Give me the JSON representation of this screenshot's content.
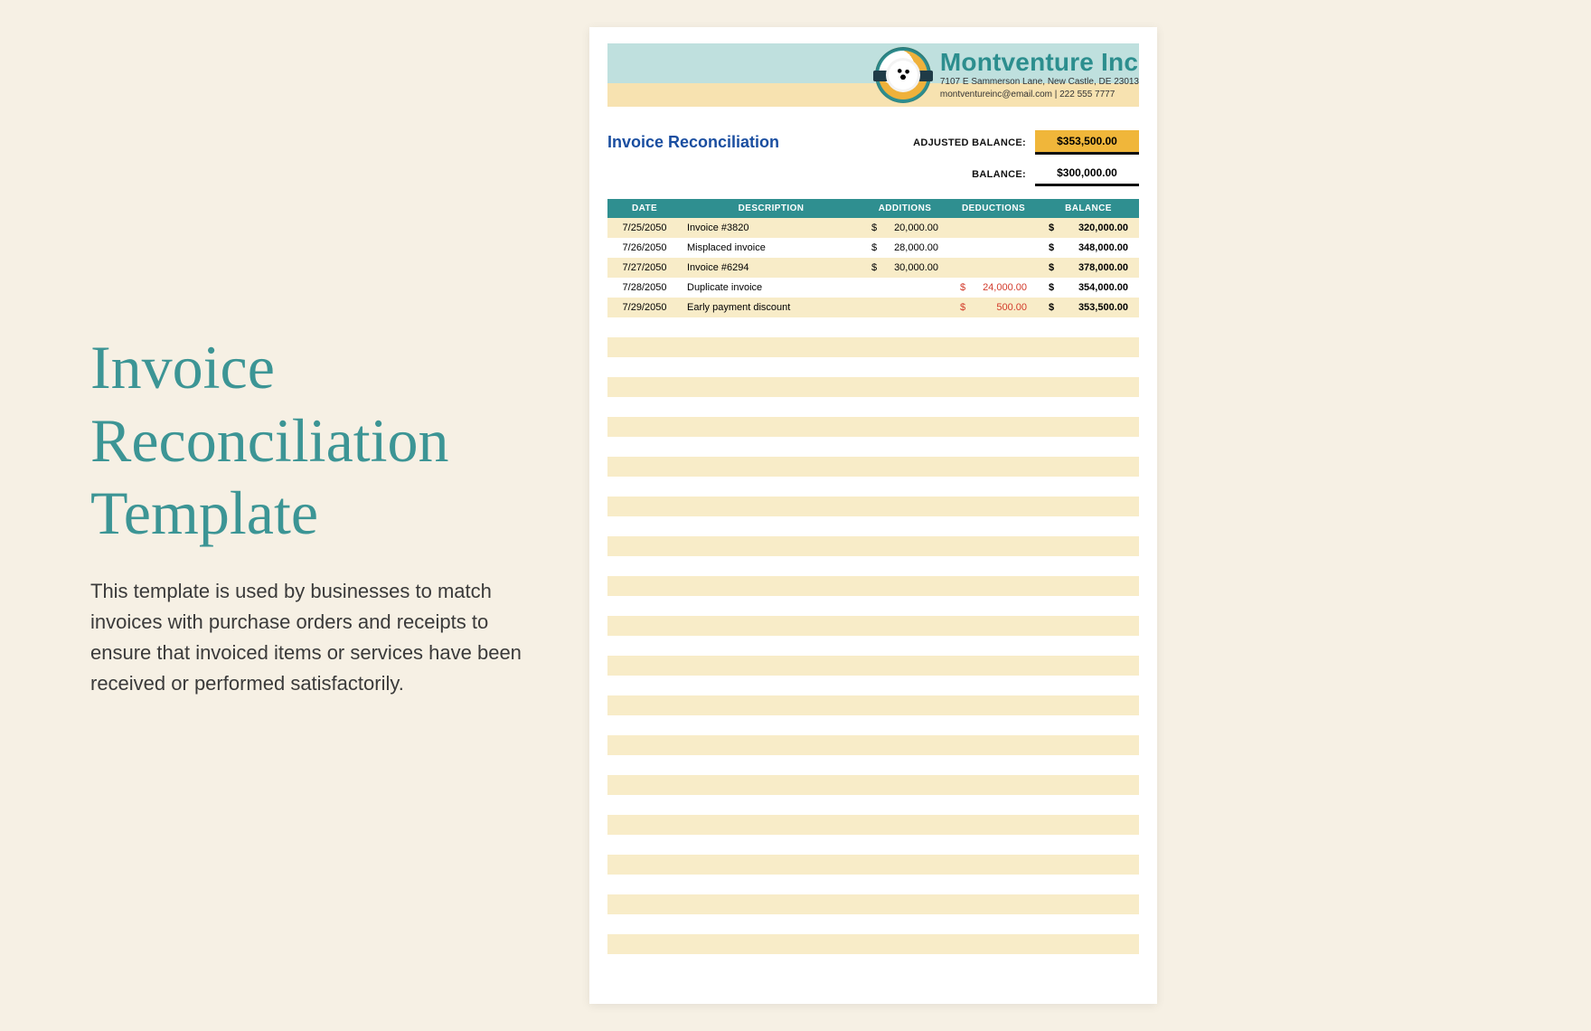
{
  "left": {
    "title": "Invoice Reconciliation Template",
    "description": "This template is used by businesses to match invoices with purchase orders and receipts to ensure that invoiced items or services have been received or performed satisfactorily."
  },
  "company": {
    "name": "Montventure Inc",
    "address": "7107 E Sammerson Lane, New Castle, DE 23013",
    "contact": "montventureinc@email.com | 222 555 7777"
  },
  "doc": {
    "title": "Invoice Reconciliation",
    "adjusted_label": "ADJUSTED BALANCE:",
    "adjusted_value": "$353,500.00",
    "balance_label": "BALANCE:",
    "balance_value": "$300,000.00"
  },
  "columns": {
    "date": "DATE",
    "description": "DESCRIPTION",
    "additions": "ADDITIONS",
    "deductions": "DEDUCTIONS",
    "balance": "BALANCE"
  },
  "rows": [
    {
      "date": "7/25/2050",
      "desc": "Invoice #3820",
      "add": "20,000.00",
      "ded": "",
      "bal": "320,000.00"
    },
    {
      "date": "7/26/2050",
      "desc": "Misplaced invoice",
      "add": "28,000.00",
      "ded": "",
      "bal": "348,000.00"
    },
    {
      "date": "7/27/2050",
      "desc": "Invoice #6294",
      "add": "30,000.00",
      "ded": "",
      "bal": "378,000.00"
    },
    {
      "date": "7/28/2050",
      "desc": "Duplicate invoice",
      "add": "",
      "ded": "24,000.00",
      "bal": "354,000.00"
    },
    {
      "date": "7/29/2050",
      "desc": "Early payment discount",
      "add": "",
      "ded": "500.00",
      "bal": "353,500.00"
    }
  ],
  "empty_rows": 33
}
